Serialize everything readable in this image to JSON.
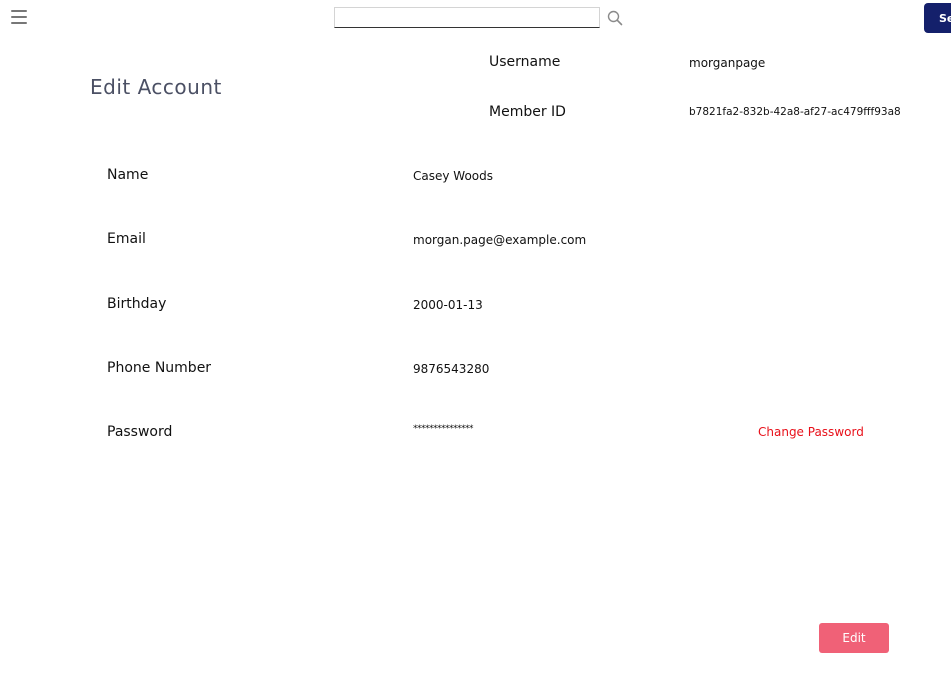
{
  "header": {
    "search": {
      "value": "",
      "placeholder": ""
    },
    "search_button_label": "Se"
  },
  "account": {
    "title": "Edit Account",
    "username_label": "Username",
    "username_value": "morganpage",
    "member_id_label": "Member ID",
    "member_id_value": "b7821fa2-832b-42a8-af27-ac479fff93a8"
  },
  "fields": [
    {
      "label": "Name",
      "value": "Casey Woods"
    },
    {
      "label": "Email",
      "value": "morgan.page@example.com"
    },
    {
      "label": "Birthday",
      "value": "2000-01-13"
    },
    {
      "label": "Phone Number",
      "value": "9876543280"
    },
    {
      "label": "Password",
      "value": "***************"
    }
  ],
  "actions": {
    "change_password_label": "Change Password",
    "edit_label": "Edit"
  },
  "colors": {
    "search_button": "#14206b",
    "edit_button": "#f06177",
    "link": "#e8101a",
    "title": "#4b5064"
  },
  "icons": {
    "menu": "hamburger-menu-icon",
    "search": "search-icon"
  }
}
